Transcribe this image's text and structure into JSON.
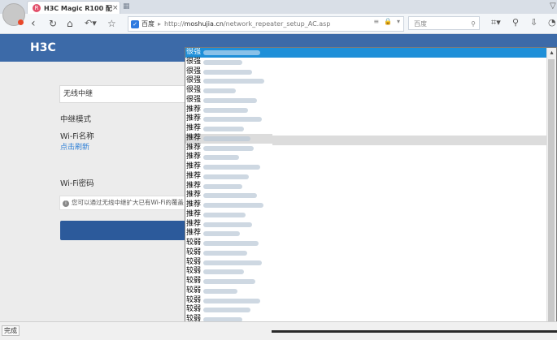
{
  "browser": {
    "tab_title": "H3C Magic R100 配置...",
    "tab_close": "×",
    "tab_favicon": "R",
    "address_site": "百度",
    "address_url_prefix": "http://",
    "address_url_domain": "moshujia.cn",
    "address_url_path": "/network_repeater_setup_AC.asp",
    "address_icons": [
      "≡",
      "🔒",
      "▾"
    ],
    "search_placeholder": "百度",
    "nav_icons": [
      "‹",
      "↻",
      "⌂",
      "↶▾",
      "☆"
    ],
    "tool_icons": [
      "⌗▾",
      "⚲",
      "⇩",
      "◔"
    ]
  },
  "page": {
    "logo": "H3C",
    "mode_field_value": "无线中继",
    "label_mode": "中继模式",
    "label_wifi_name": "Wi-Fi名称",
    "refresh_link": "点击刷新",
    "label_wifi_password": "Wi-Fi密码",
    "info_text": "您可以通过无线中继扩大已有Wi-Fi的覆盖"
  },
  "dropdown": {
    "rows": [
      {
        "label": "很强",
        "state": "selected"
      },
      {
        "label": "很强"
      },
      {
        "label": "很强"
      },
      {
        "label": "很强"
      },
      {
        "label": "很强"
      },
      {
        "label": "很强"
      },
      {
        "label": "推荐"
      },
      {
        "label": "推荐"
      },
      {
        "label": "推荐"
      },
      {
        "label": "推荐",
        "state": "hover"
      },
      {
        "label": "推荐"
      },
      {
        "label": "推荐"
      },
      {
        "label": "推荐"
      },
      {
        "label": "推荐"
      },
      {
        "label": "推荐"
      },
      {
        "label": "推荐"
      },
      {
        "label": "推荐"
      },
      {
        "label": "推荐"
      },
      {
        "label": "推荐"
      },
      {
        "label": "推荐"
      },
      {
        "label": "较弱"
      },
      {
        "label": "较弱"
      },
      {
        "label": "较弱"
      },
      {
        "label": "较弱"
      },
      {
        "label": "较弱"
      },
      {
        "label": "较弱"
      },
      {
        "label": "较弱"
      },
      {
        "label": "较弱"
      },
      {
        "label": "较弱"
      },
      {
        "label": "较弱"
      }
    ],
    "scroll_up": "▴",
    "scroll_down": "▾"
  },
  "status": {
    "text": "完成"
  }
}
